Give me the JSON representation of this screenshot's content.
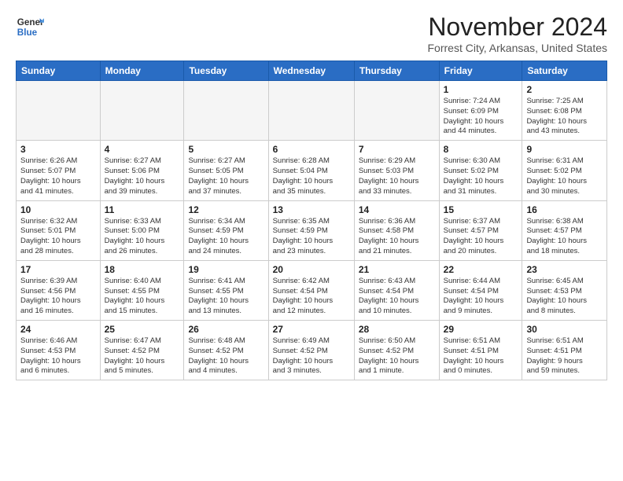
{
  "logo": {
    "line1": "General",
    "line2": "Blue"
  },
  "title": "November 2024",
  "subtitle": "Forrest City, Arkansas, United States",
  "weekdays": [
    "Sunday",
    "Monday",
    "Tuesday",
    "Wednesday",
    "Thursday",
    "Friday",
    "Saturday"
  ],
  "weeks": [
    [
      {
        "day": "",
        "info": ""
      },
      {
        "day": "",
        "info": ""
      },
      {
        "day": "",
        "info": ""
      },
      {
        "day": "",
        "info": ""
      },
      {
        "day": "",
        "info": ""
      },
      {
        "day": "1",
        "info": "Sunrise: 7:24 AM\nSunset: 6:09 PM\nDaylight: 10 hours\nand 44 minutes."
      },
      {
        "day": "2",
        "info": "Sunrise: 7:25 AM\nSunset: 6:08 PM\nDaylight: 10 hours\nand 43 minutes."
      }
    ],
    [
      {
        "day": "3",
        "info": "Sunrise: 6:26 AM\nSunset: 5:07 PM\nDaylight: 10 hours\nand 41 minutes."
      },
      {
        "day": "4",
        "info": "Sunrise: 6:27 AM\nSunset: 5:06 PM\nDaylight: 10 hours\nand 39 minutes."
      },
      {
        "day": "5",
        "info": "Sunrise: 6:27 AM\nSunset: 5:05 PM\nDaylight: 10 hours\nand 37 minutes."
      },
      {
        "day": "6",
        "info": "Sunrise: 6:28 AM\nSunset: 5:04 PM\nDaylight: 10 hours\nand 35 minutes."
      },
      {
        "day": "7",
        "info": "Sunrise: 6:29 AM\nSunset: 5:03 PM\nDaylight: 10 hours\nand 33 minutes."
      },
      {
        "day": "8",
        "info": "Sunrise: 6:30 AM\nSunset: 5:02 PM\nDaylight: 10 hours\nand 31 minutes."
      },
      {
        "day": "9",
        "info": "Sunrise: 6:31 AM\nSunset: 5:02 PM\nDaylight: 10 hours\nand 30 minutes."
      }
    ],
    [
      {
        "day": "10",
        "info": "Sunrise: 6:32 AM\nSunset: 5:01 PM\nDaylight: 10 hours\nand 28 minutes."
      },
      {
        "day": "11",
        "info": "Sunrise: 6:33 AM\nSunset: 5:00 PM\nDaylight: 10 hours\nand 26 minutes."
      },
      {
        "day": "12",
        "info": "Sunrise: 6:34 AM\nSunset: 4:59 PM\nDaylight: 10 hours\nand 24 minutes."
      },
      {
        "day": "13",
        "info": "Sunrise: 6:35 AM\nSunset: 4:59 PM\nDaylight: 10 hours\nand 23 minutes."
      },
      {
        "day": "14",
        "info": "Sunrise: 6:36 AM\nSunset: 4:58 PM\nDaylight: 10 hours\nand 21 minutes."
      },
      {
        "day": "15",
        "info": "Sunrise: 6:37 AM\nSunset: 4:57 PM\nDaylight: 10 hours\nand 20 minutes."
      },
      {
        "day": "16",
        "info": "Sunrise: 6:38 AM\nSunset: 4:57 PM\nDaylight: 10 hours\nand 18 minutes."
      }
    ],
    [
      {
        "day": "17",
        "info": "Sunrise: 6:39 AM\nSunset: 4:56 PM\nDaylight: 10 hours\nand 16 minutes."
      },
      {
        "day": "18",
        "info": "Sunrise: 6:40 AM\nSunset: 4:55 PM\nDaylight: 10 hours\nand 15 minutes."
      },
      {
        "day": "19",
        "info": "Sunrise: 6:41 AM\nSunset: 4:55 PM\nDaylight: 10 hours\nand 13 minutes."
      },
      {
        "day": "20",
        "info": "Sunrise: 6:42 AM\nSunset: 4:54 PM\nDaylight: 10 hours\nand 12 minutes."
      },
      {
        "day": "21",
        "info": "Sunrise: 6:43 AM\nSunset: 4:54 PM\nDaylight: 10 hours\nand 10 minutes."
      },
      {
        "day": "22",
        "info": "Sunrise: 6:44 AM\nSunset: 4:54 PM\nDaylight: 10 hours\nand 9 minutes."
      },
      {
        "day": "23",
        "info": "Sunrise: 6:45 AM\nSunset: 4:53 PM\nDaylight: 10 hours\nand 8 minutes."
      }
    ],
    [
      {
        "day": "24",
        "info": "Sunrise: 6:46 AM\nSunset: 4:53 PM\nDaylight: 10 hours\nand 6 minutes."
      },
      {
        "day": "25",
        "info": "Sunrise: 6:47 AM\nSunset: 4:52 PM\nDaylight: 10 hours\nand 5 minutes."
      },
      {
        "day": "26",
        "info": "Sunrise: 6:48 AM\nSunset: 4:52 PM\nDaylight: 10 hours\nand 4 minutes."
      },
      {
        "day": "27",
        "info": "Sunrise: 6:49 AM\nSunset: 4:52 PM\nDaylight: 10 hours\nand 3 minutes."
      },
      {
        "day": "28",
        "info": "Sunrise: 6:50 AM\nSunset: 4:52 PM\nDaylight: 10 hours\nand 1 minute."
      },
      {
        "day": "29",
        "info": "Sunrise: 6:51 AM\nSunset: 4:51 PM\nDaylight: 10 hours\nand 0 minutes."
      },
      {
        "day": "30",
        "info": "Sunrise: 6:51 AM\nSunset: 4:51 PM\nDaylight: 9 hours\nand 59 minutes."
      }
    ]
  ]
}
